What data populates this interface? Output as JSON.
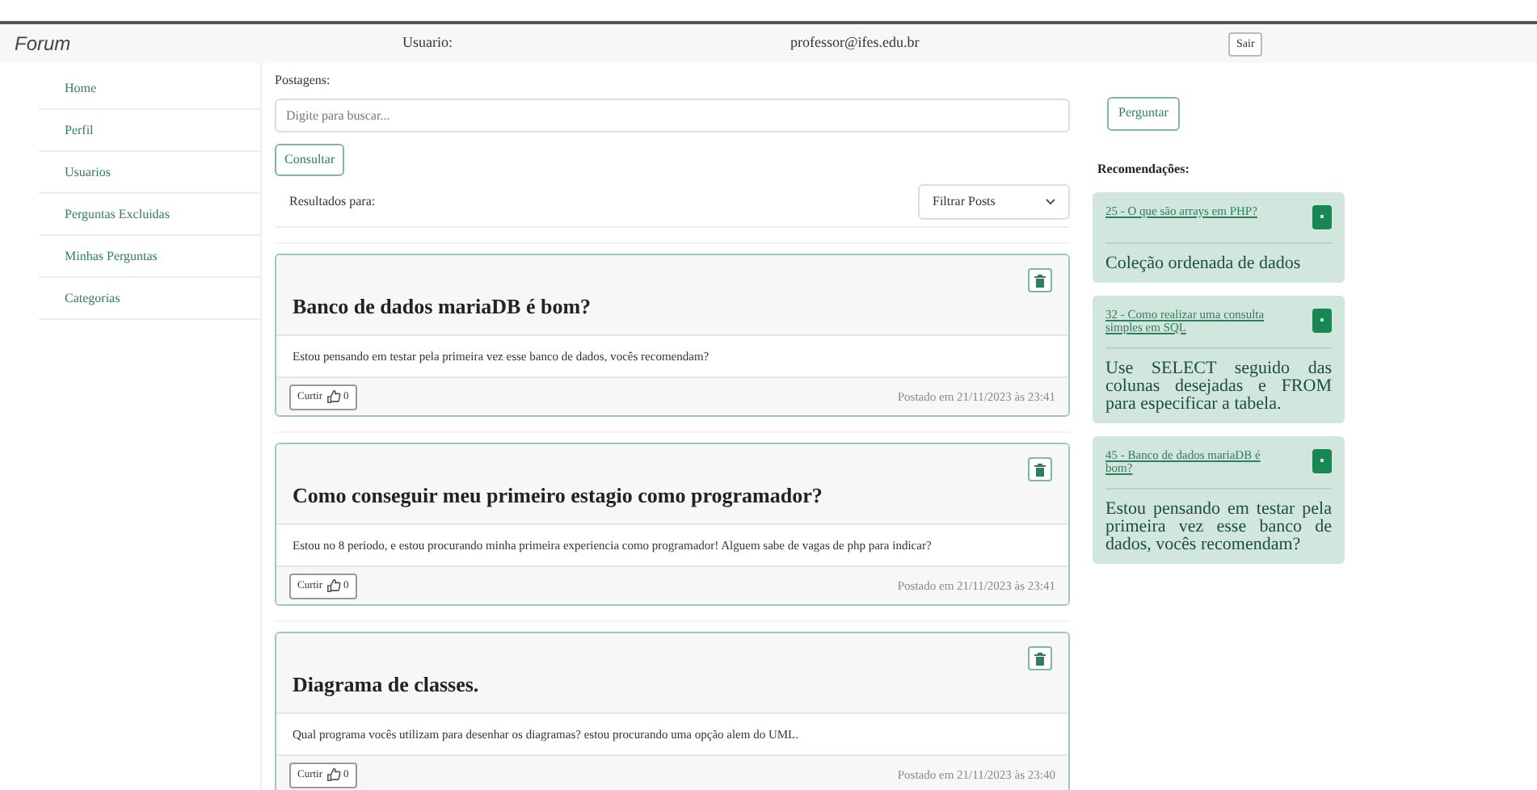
{
  "navbar": {
    "brand": "Forum",
    "user_label": "Usuario:",
    "user_email": "professor@ifes.edu.br",
    "logout": "Sair"
  },
  "sidebar": {
    "items": [
      {
        "label": "Home"
      },
      {
        "label": "Perfil"
      },
      {
        "label": "Usuarios"
      },
      {
        "label": "Perguntas Excluidas"
      },
      {
        "label": "Minhas Perguntas"
      },
      {
        "label": "Categorias"
      }
    ]
  },
  "search": {
    "label": "Postagens:",
    "placeholder": "Digite para buscar...",
    "button": "Consultar",
    "results_label": "Resultados para:",
    "filter": "Filtrar Posts"
  },
  "posts": [
    {
      "title": "Banco de dados mariaDB é bom?",
      "body": "Estou pensando em testar pela primeira vez esse banco de dados, vocês recomendam?",
      "like": "Curtir",
      "likes": "0",
      "posted": "Postado em 21/11/2023 às 23:41"
    },
    {
      "title": "Como conseguir meu primeiro estagio como programador?",
      "body": "Estou no 8 periodo, e estou procurando minha primeira experiencia como programador! Alguem sabe de vagas de php para indicar?",
      "like": "Curtir",
      "likes": "0",
      "posted": "Postado em 21/11/2023 às 23:41"
    },
    {
      "title": "Diagrama de classes.",
      "body": "Qual programa vocês utilizam para desenhar os diagramas? estou procurando uma opção alem do UML.",
      "like": "Curtir",
      "likes": "0",
      "posted": "Postado em 21/11/2023 às 23:40"
    }
  ],
  "ask_button": "Perguntar",
  "recommendations": {
    "title": "Recomendações:",
    "items": [
      {
        "link": "25 - O que são arrays em PHP?",
        "text": "Coleção ordenada de dados"
      },
      {
        "link": "32 - Como realizar uma consulta simples em SQL",
        "text": "Use SELECT seguido das colunas desejadas e FROM para especificar a tabela."
      },
      {
        "link": "45 - Banco de dados mariaDB é bom?",
        "text": "Estou pensando em testar pela primeira vez esse banco de dados, vocês recomendam?"
      }
    ]
  }
}
